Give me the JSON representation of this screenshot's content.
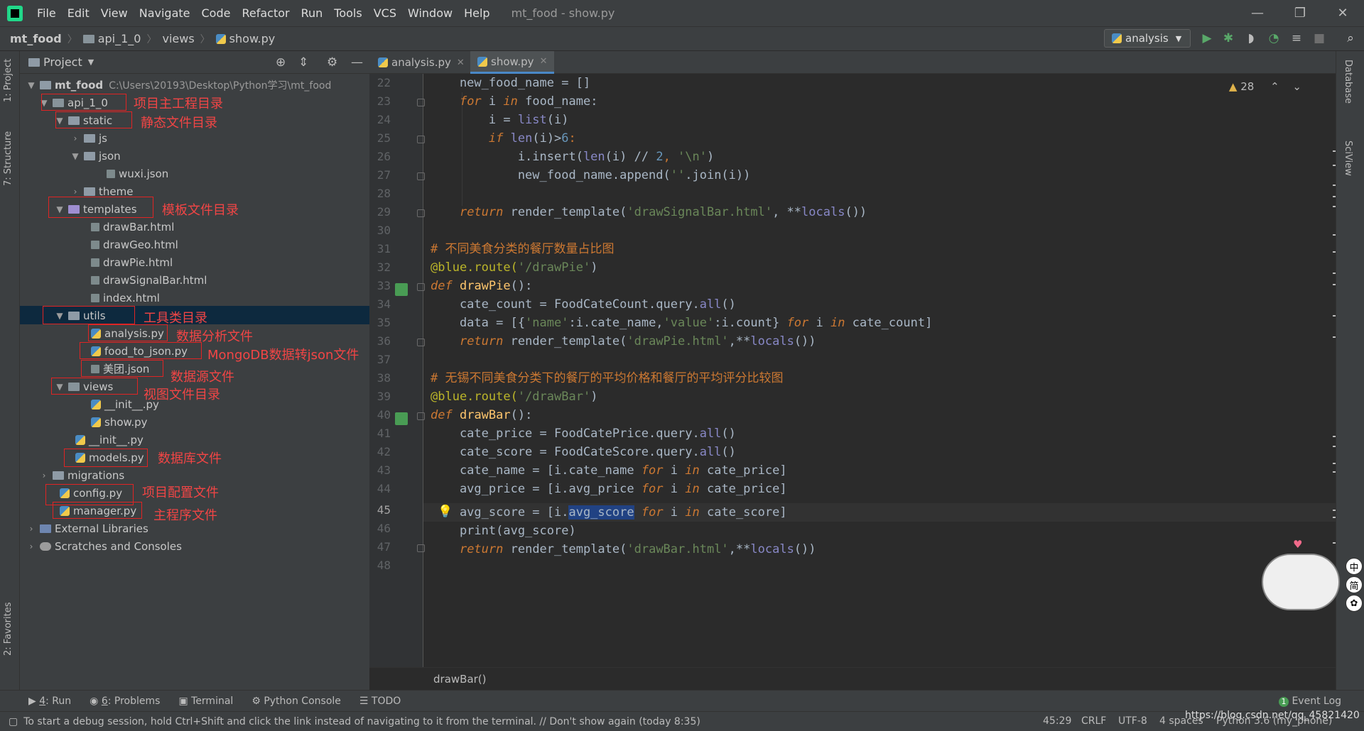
{
  "app": {
    "window_title": "mt_food - show.py",
    "menu": [
      "File",
      "Edit",
      "View",
      "Navigate",
      "Code",
      "Refactor",
      "Run",
      "Tools",
      "VCS",
      "Window",
      "Help"
    ]
  },
  "nav": {
    "crumbs": [
      "mt_food",
      "api_1_0",
      "views",
      "show.py"
    ],
    "run_config": "analysis"
  },
  "project": {
    "title": "Project",
    "root": {
      "name": "mt_food",
      "path": "C:\\Users\\20193\\Desktop\\Python学习\\mt_food"
    },
    "items": [
      {
        "label": "api_1_0",
        "note": "项目主工程目录"
      },
      {
        "label": "static",
        "note": "静态文件目录"
      },
      {
        "label": "js"
      },
      {
        "label": "json"
      },
      {
        "label": "wuxi.json"
      },
      {
        "label": "theme"
      },
      {
        "label": "templates",
        "note": "模板文件目录"
      },
      {
        "label": "drawBar.html"
      },
      {
        "label": "drawGeo.html"
      },
      {
        "label": "drawPie.html"
      },
      {
        "label": "drawSignalBar.html"
      },
      {
        "label": "index.html"
      },
      {
        "label": "utils",
        "note": "工具类目录"
      },
      {
        "label": "analysis.py",
        "note": "数据分析文件"
      },
      {
        "label": "food_to_json.py",
        "note": "MongoDB数据转json文件"
      },
      {
        "label": "美团.json",
        "note": "数据源文件"
      },
      {
        "label": "views",
        "note": "视图文件目录"
      },
      {
        "label": "__init__.py"
      },
      {
        "label": "show.py"
      },
      {
        "label": "__init__.py"
      },
      {
        "label": "models.py",
        "note": "数据库文件"
      },
      {
        "label": "migrations"
      },
      {
        "label": "config.py",
        "note": "项目配置文件"
      },
      {
        "label": "manager.py",
        "note": "主程序文件"
      },
      {
        "label": "External Libraries"
      },
      {
        "label": "Scratches and Consoles"
      }
    ]
  },
  "tabs": [
    {
      "label": "analysis.py"
    },
    {
      "label": "show.py"
    }
  ],
  "editor": {
    "warnings": "28",
    "line_numbers": [
      "22",
      "23",
      "24",
      "25",
      "26",
      "27",
      "28",
      "29",
      "30",
      "31",
      "32",
      "33",
      "34",
      "35",
      "36",
      "37",
      "38",
      "39",
      "40",
      "41",
      "42",
      "43",
      "44",
      "45",
      "46",
      "47",
      "48"
    ],
    "code": {
      "l22": {
        "a": "    new_food_name = []"
      },
      "l23": {
        "kw1": "for",
        "a": " i ",
        "kw2": "in",
        "b": " food_name:"
      },
      "l24": {
        "a": "        i = ",
        "bi": "list",
        "b": "(i)"
      },
      "l25": {
        "kw": "if",
        "a": " ",
        "bi": "len",
        "b": "(i)>",
        "n": "6",
        "c": ":"
      },
      "l26": {
        "a": "            i.insert(",
        "bi": "len",
        "b": "(i) // ",
        "n": "2",
        "c": ", ",
        "s": "'\\n'",
        "d": ")"
      },
      "l27": {
        "a": "            new_food_name.append(",
        "s": "''",
        "b": ".join(i))"
      },
      "l28": {
        "a": ""
      },
      "l29": {
        "kw": "return",
        "a": " render_template(",
        "s": "'drawSignalBar.html'",
        "b": ", **",
        "bi": "locals",
        "c": "())"
      },
      "l30": {
        "a": ""
      },
      "l31": {
        "a": "# 不同美食分类的餐厅数量占比图"
      },
      "l32": {
        "a": "@blue.route(",
        "s": "'/drawPie'",
        "b": ")"
      },
      "l33": {
        "kw": "def",
        "fn": "drawPie",
        "a": "():"
      },
      "l34": {
        "a": "    cate_count = FoodCateCount.query.",
        "bi": "all",
        "b": "()"
      },
      "l35": {
        "a": "    data = [{",
        "s1": "'name'",
        "b": ":i.cate_name,",
        "s2": "'value'",
        "c": ":i.count} ",
        "kw1": "for",
        "d": " i ",
        "kw2": "in",
        "e": " cate_count]"
      },
      "l36": {
        "kw": "return",
        "a": " render_template(",
        "s": "'drawPie.html'",
        "b": ",**",
        "bi": "locals",
        "c": "())"
      },
      "l37": {
        "a": ""
      },
      "l38": {
        "a": "# 无锡不同美食分类下的餐厅的平均价格和餐厅的平均评分比较图"
      },
      "l39": {
        "a": "@blue.route(",
        "s": "'/drawBar'",
        "b": ")"
      },
      "l40": {
        "kw": "def",
        "fn": "drawBar",
        "a": "():"
      },
      "l41": {
        "a": "    cate_price = FoodCatePrice.query.",
        "bi": "all",
        "b": "()"
      },
      "l42": {
        "a": "    cate_score = FoodCateScore.query.",
        "bi": "all",
        "b": "()"
      },
      "l43": {
        "a": "    cate_name = [i.cate_name ",
        "kw1": "for",
        "b": " i ",
        "kw2": "in",
        "c": " cate_price]"
      },
      "l44": {
        "a": "    avg_price = [i.avg_price ",
        "kw1": "for",
        "b": " i ",
        "kw2": "in",
        "c": " cate_price]"
      },
      "l45": {
        "a": "    avg_score = [i.",
        "sel": "avg_score",
        "b": " ",
        "kw1": "for",
        "c": " i ",
        "kw2": "in",
        "d": " cate_score]"
      },
      "l46": {
        "a": "    print(avg_score)"
      },
      "l47": {
        "kw": "return",
        "a": " render_template(",
        "s": "'drawBar.html'",
        "b": ",**",
        "bi": "locals",
        "c": "())"
      },
      "l48": {
        "a": ""
      }
    },
    "breadcrumb": "drawBar()"
  },
  "left_tool_tabs": [
    "1: Project",
    "7: Structure",
    "2: Favorites"
  ],
  "right_tool_tabs": [
    "Database",
    "SciView"
  ],
  "bottom_tabs": [
    {
      "num": "4",
      "label": ": Run"
    },
    {
      "num": "6",
      "label": ": Problems"
    },
    {
      "label": "Terminal"
    },
    {
      "label": "Python Console"
    },
    {
      "label": "TODO"
    }
  ],
  "event_log": "Event Log",
  "event_count": "1",
  "status": {
    "message": "To start a debug session, hold Ctrl+Shift and click the link instead of navigating to it from the terminal. // Don't show again (today 8:35)",
    "position": "45:29",
    "line_sep": "CRLF",
    "encoding": "UTF-8",
    "indent": "4 spaces",
    "interpreter": "Python 3.6 (my_phone)",
    "watermark": "https://blog.csdn.net/qq_45821420"
  },
  "ime": [
    "中",
    "简"
  ]
}
